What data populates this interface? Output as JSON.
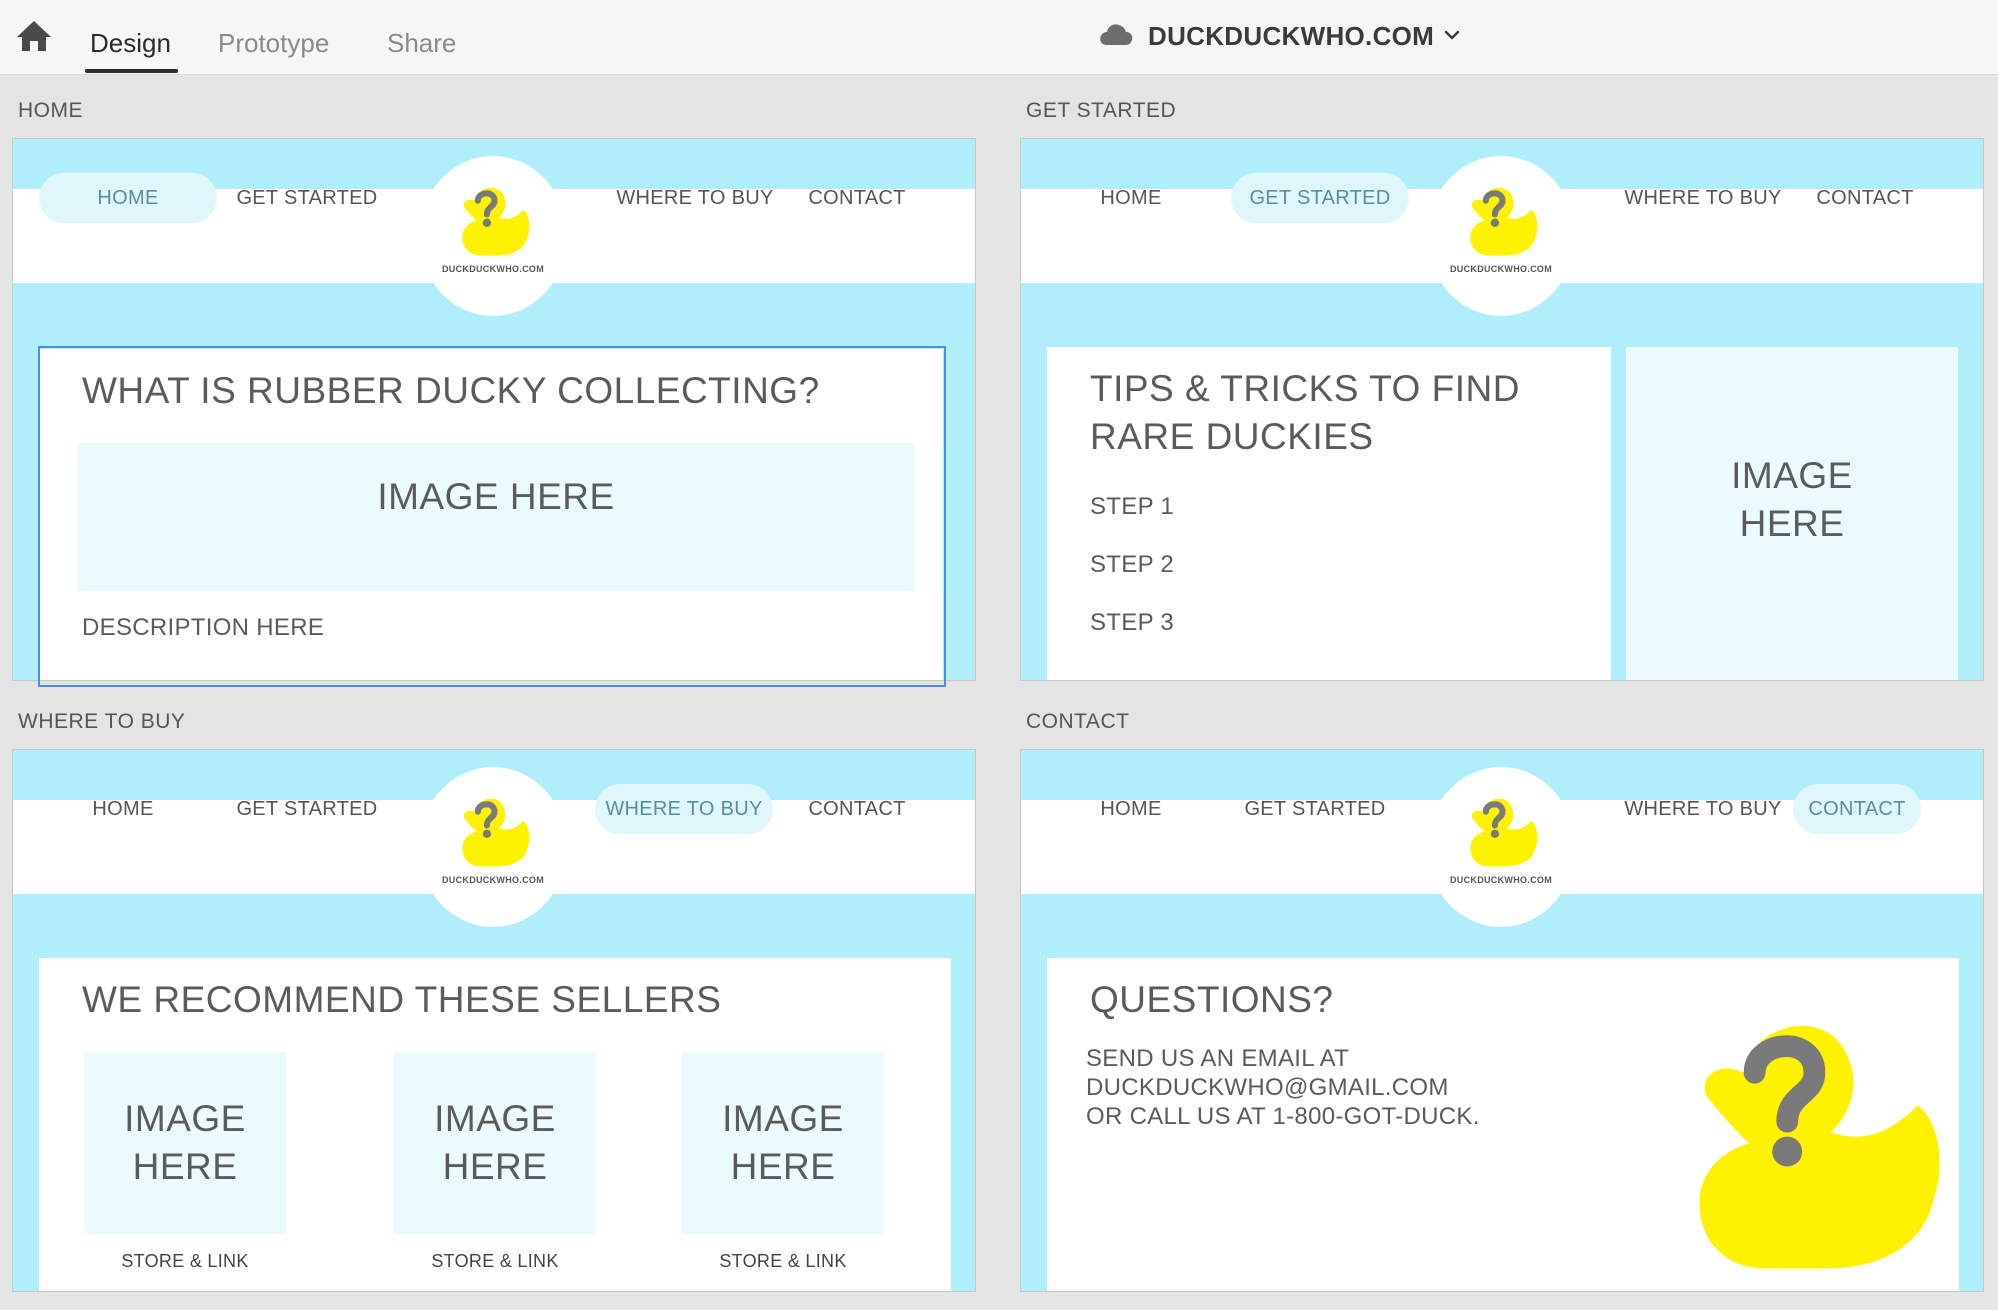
{
  "toolbar": {
    "tabs": [
      "Design",
      "Prototype",
      "Share"
    ],
    "active_tab": "Design",
    "document_title": "DUCKDUCKWHO.COM",
    "icons": {
      "home": "home-icon",
      "cloud": "cloud-icon",
      "chevron": "chevron-down-icon"
    }
  },
  "site": {
    "nav": [
      "HOME",
      "GET STARTED",
      "WHERE TO BUY",
      "CONTACT"
    ],
    "logo_text": "DUCKDUCKWHO.COM"
  },
  "colors": {
    "sky": "#b0eefb",
    "pill": "#dff6fb",
    "duck": "#fff200",
    "question": "#7a7a7a",
    "selection": "#4a8df0"
  },
  "artboards": {
    "home": {
      "label": "HOME",
      "heading": "WHAT IS RUBBER DUCKY COLLECTING?",
      "image": "IMAGE HERE",
      "description": "DESCRIPTION HERE"
    },
    "get_started": {
      "label": "GET STARTED",
      "heading_line1": "TIPS & TRICKS TO FIND",
      "heading_line2": "RARE DUCKIES",
      "steps": [
        "STEP 1",
        "STEP 2",
        "STEP 3"
      ],
      "image_line1": "IMAGE",
      "image_line2": "HERE"
    },
    "where_to_buy": {
      "label": "WHERE TO BUY",
      "heading": "WE RECOMMEND THESE SELLERS",
      "sellers": [
        {
          "image_line1": "IMAGE",
          "image_line2": "HERE",
          "link": "STORE & LINK"
        },
        {
          "image_line1": "IMAGE",
          "image_line2": "HERE",
          "link": "STORE & LINK"
        },
        {
          "image_line1": "IMAGE",
          "image_line2": "HERE",
          "link": "STORE & LINK"
        }
      ]
    },
    "contact": {
      "label": "CONTACT",
      "heading": "QUESTIONS?",
      "line1": "SEND US AN EMAIL AT",
      "line2": "DUCKDUCKWHO@GMAIL.COM",
      "line3": "OR CALL US AT 1-800-GOT-DUCK."
    }
  }
}
